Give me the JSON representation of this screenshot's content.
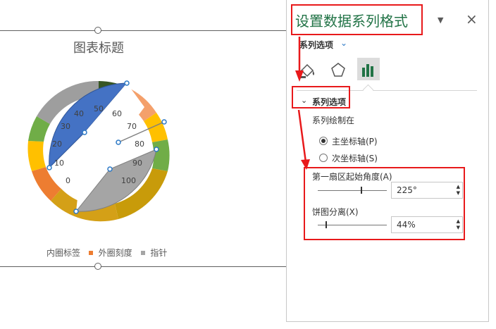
{
  "chart": {
    "title": "图表标题",
    "legend": [
      {
        "label": "内圈标签",
        "color": "#ffffff"
      },
      {
        "label": "外圈刻度",
        "color": "#ed7d31"
      },
      {
        "label": "指针",
        "color": "#a5a5a5"
      }
    ],
    "scale_labels": [
      "0",
      "10",
      "20",
      "30",
      "40",
      "50",
      "60",
      "70",
      "80",
      "90",
      "100"
    ]
  },
  "pane": {
    "title": "设置数据系列格式",
    "dropdown_icon": "caret-down",
    "close_icon": "×",
    "series_options_menu": "系列选项",
    "section_title": "系列选项",
    "plot_on_label": "系列绘制在",
    "primary_axis": "主坐标轴(P)",
    "secondary_axis": "次坐标轴(S)",
    "primary_selected": true,
    "first_slice_angle_label": "第一扇区起始角度(A)",
    "first_slice_angle_value": "225°",
    "first_slice_angle": 225,
    "explosion_label": "饼图分离(X)",
    "explosion_value": "44%",
    "explosion": 44
  },
  "colors": {
    "accent_green": "#217346",
    "annotation_red": "#e8191b"
  }
}
